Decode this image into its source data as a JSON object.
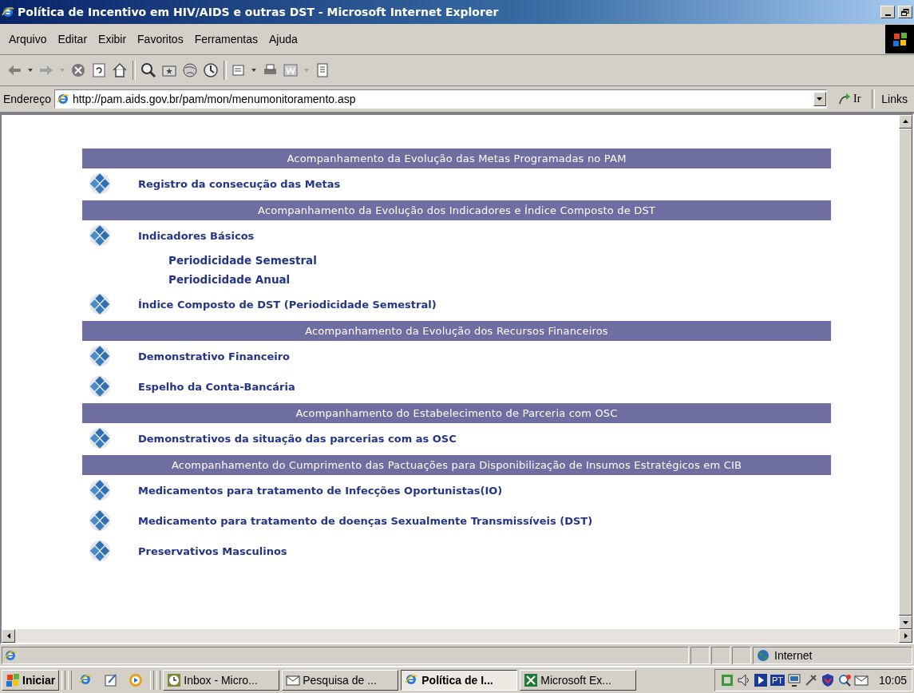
{
  "window": {
    "title": "Política de Incentivo em HIV/AIDS e outras DST - Microsoft Internet Explorer"
  },
  "menu_bar": [
    "Arquivo",
    "Editar",
    "Exibir",
    "Favoritos",
    "Ferramentas",
    "Ajuda"
  ],
  "address_bar": {
    "label": "Endereço",
    "url": "http://pam.aids.gov.br/pam/mon/menumonitoramento.asp",
    "go_button": "Ir",
    "links": "Links"
  },
  "sections": [
    {
      "heading": "Acompanhamento da Evolução das Metas Programadas no PAM",
      "items": [
        {
          "kind": "main",
          "label": "Registro da consecução das Metas"
        }
      ]
    },
    {
      "heading": "Acompanhamento da Evolução dos Indicadores e Índice Composto de DST",
      "items": [
        {
          "kind": "main",
          "label": "Indicadores Básicos"
        },
        {
          "kind": "sub",
          "label": "Periodicidade Semestral"
        },
        {
          "kind": "sub",
          "label": "Periodicidade Anual"
        },
        {
          "kind": "main",
          "label": "Índice Composto de DST (Periodicidade Semestral)"
        }
      ]
    },
    {
      "heading": "Acompanhamento da Evolução dos Recursos Financeiros",
      "items": [
        {
          "kind": "main",
          "label": "Demonstrativo Financeiro"
        },
        {
          "kind": "main",
          "label": "Espelho da Conta-Bancária"
        }
      ]
    },
    {
      "heading": "Acompanhamento do Estabelecimento de Parceria com OSC",
      "items": [
        {
          "kind": "main",
          "label": "Demonstrativos da situação das parcerias com as OSC"
        }
      ]
    },
    {
      "heading": "Acompanhamento do Cumprimento das Pactuações para Disponibilização de Insumos Estratégicos em CIB",
      "items": [
        {
          "kind": "main",
          "label": "Medicamentos para tratamento de Infecções Oportunistas(IO)"
        },
        {
          "kind": "main",
          "label": "Medicamento para tratamento de doenças Sexualmente Transmissíveis (DST)"
        },
        {
          "kind": "main",
          "label": "Preservativos Masculinos"
        }
      ]
    }
  ],
  "status_bar": {
    "zone": "Internet"
  },
  "taskbar": {
    "start": "Iniciar",
    "tasks": [
      {
        "label": "Inbox - Micro...",
        "selected": false
      },
      {
        "label": "Pesquisa de ...",
        "selected": false
      },
      {
        "label": "Política de I...",
        "selected": true
      },
      {
        "label": "Microsoft Ex...",
        "selected": false
      }
    ],
    "tray": {
      "language": "PT",
      "time": "10:05"
    }
  }
}
